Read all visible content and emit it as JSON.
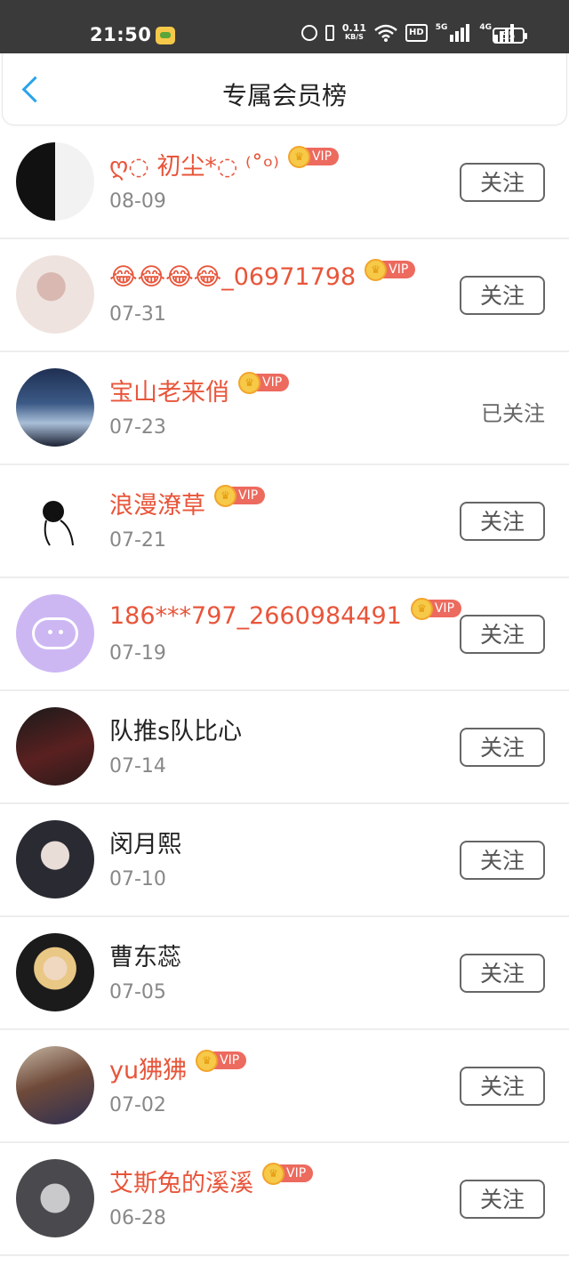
{
  "status_bar": {
    "time": "21:50",
    "speed_value": "0.11",
    "speed_unit": "KB/S",
    "hd": "HD",
    "net1": "5G",
    "net2": "4G",
    "battery": "55"
  },
  "header": {
    "title": "专属会员榜"
  },
  "vip_tag": "VIP",
  "follow_label": "关注",
  "followed_label": "已关注",
  "members": [
    {
      "name": "ღ◌ 初尘*◌ ⁽˚ᵒ⁾",
      "date": "08-09",
      "vip": true,
      "followed": false,
      "avatar": "ink-text"
    },
    {
      "name": "😂😂😂😂_06971798",
      "date": "07-31",
      "vip": true,
      "followed": false,
      "avatar": "girl-pink"
    },
    {
      "name": "宝山老来俏",
      "date": "07-23",
      "vip": true,
      "followed": true,
      "avatar": "sea-girl"
    },
    {
      "name": "浪漫潦草",
      "date": "07-21",
      "vip": true,
      "followed": false,
      "avatar": "sketch"
    },
    {
      "name": "186***797_2660984491",
      "date": "07-19",
      "vip": true,
      "followed": false,
      "avatar": "chat-bubble"
    },
    {
      "name": "队推s队比心",
      "date": "07-14",
      "vip": false,
      "followed": false,
      "avatar": "dark-couch"
    },
    {
      "name": "闵月熙",
      "date": "07-10",
      "vip": false,
      "followed": false,
      "avatar": "boy-dark"
    },
    {
      "name": "曹东蕊",
      "date": "07-05",
      "vip": false,
      "followed": false,
      "avatar": "girl-blonde"
    },
    {
      "name": "yu狒狒",
      "date": "07-02",
      "vip": true,
      "followed": false,
      "avatar": "mom-child"
    },
    {
      "name": "艾斯兔的溪溪",
      "date": "06-28",
      "vip": true,
      "followed": false,
      "avatar": "pale-face"
    }
  ]
}
